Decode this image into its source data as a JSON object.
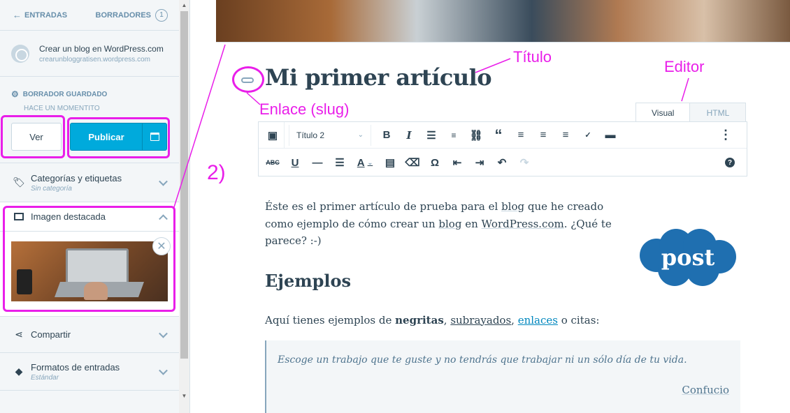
{
  "sidebar": {
    "back_label": "ENTRADAS",
    "drafts_label": "BORRADORES",
    "drafts_count": "1",
    "site_title": "Crear un blog en WordPress.com",
    "site_url": "crearunbloggratisen.wordpress.com",
    "status_label": "BORRADOR GUARDADO",
    "status_time": "HACE UN MOMENTITO",
    "view_button": "Ver",
    "publish_button": "Publicar",
    "sections": [
      {
        "label": "Categorías y etiquetas",
        "sub": "Sin categoría"
      },
      {
        "label": "Imagen destacada",
        "sub": ""
      },
      {
        "label": "Compartir",
        "sub": ""
      },
      {
        "label": "Formatos de entradas",
        "sub": "Estándar"
      }
    ],
    "remove_symbol": "✕"
  },
  "editor": {
    "title": "Mi primer artículo",
    "tabs": [
      "Visual",
      "HTML"
    ],
    "format_select": "Título 2",
    "paragraph1_a": "Éste es el primer artículo de prueba para el ",
    "paragraph1_blog": "blog",
    "paragraph1_b": " que he creado como ejemplo de cómo crear un ",
    "paragraph1_blog2": "blog",
    "paragraph1_c": " en ",
    "paragraph1_wp": "WordPress.com",
    "paragraph1_d": ". ¿Qué te parece? :-)",
    "heading": "Ejemplos",
    "paragraph2_a": "Aquí tienes ejemplos de ",
    "paragraph2_bold": "negritas",
    "paragraph2_sep": ", ",
    "paragraph2_under": "subrayados",
    "paragraph2_link": "enlaces",
    "paragraph2_end": " o citas:",
    "quote": "Escoge un trabajo que te guste y no tendrás que trabajar ni un sólo día de tu vida.",
    "quote_author": "Confucio",
    "logo_text": "post"
  },
  "annotations": {
    "titulo": "Título",
    "editor": "Editor",
    "enlace": "Enlace (slug)",
    "step": "2)"
  },
  "colors": {
    "accent": "#00aadc",
    "annotation": "#e91ee9",
    "logo": "#1f6fb0"
  }
}
